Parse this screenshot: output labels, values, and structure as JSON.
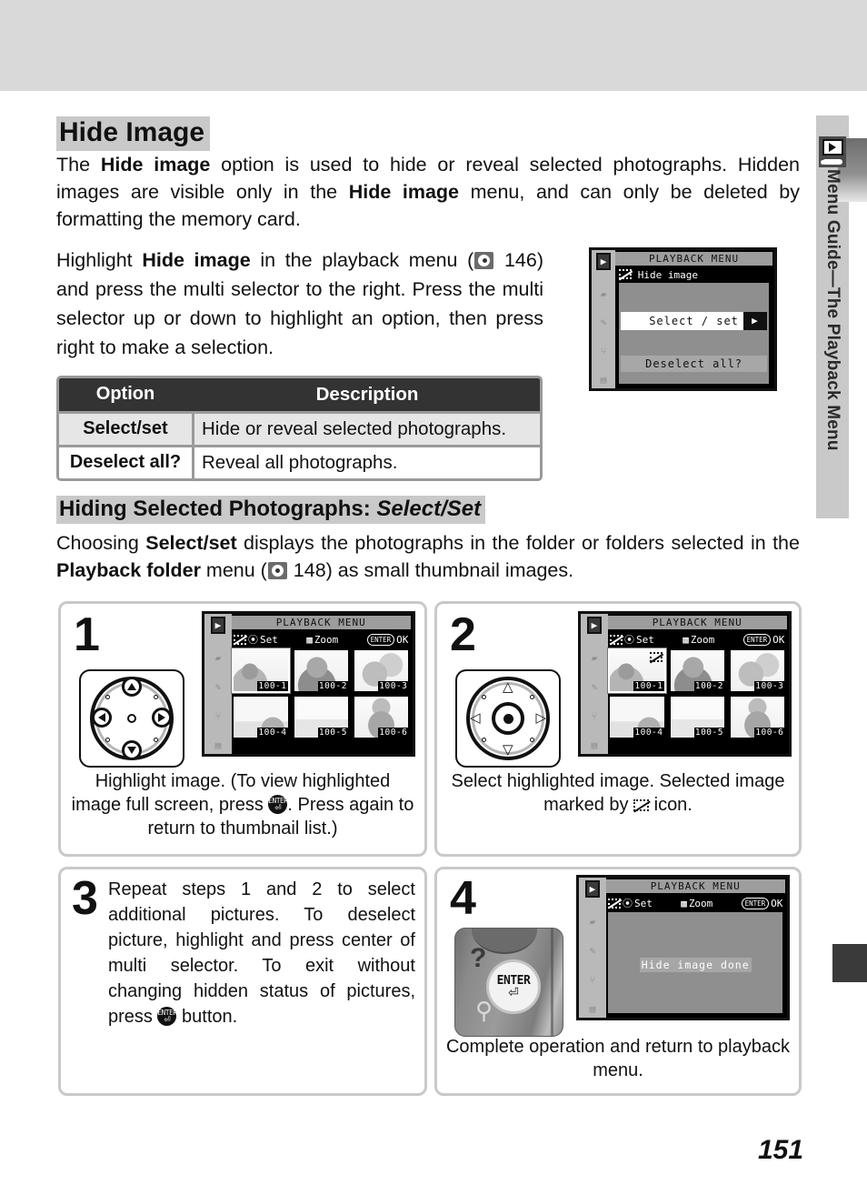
{
  "page": {
    "number": "151",
    "side_tab_label": "Menu Guide—The Playback Menu",
    "side_tab_icon": "playback-monitor-icon"
  },
  "heading": "Hide Image",
  "intro": {
    "part1": "The ",
    "bold1": "Hide image",
    "part2": " option is used to hide or reveal selected photographs.  Hidden images are visible only in the ",
    "bold2": "Hide image",
    "part3": " menu, and can only be deleted by formatting the memory card."
  },
  "instructions": {
    "part1": "Highlight ",
    "bold1": "Hide image",
    "part2": " in the playback menu (",
    "ref_page": " 146) and press the multi selector to the right. Press the multi selector up or down to highlight an option, then press right to make a selection."
  },
  "menu_screen": {
    "title": "PLAYBACK MENU",
    "item": "Hide image",
    "selected_option": "Select / set",
    "selected_arrow": "▶",
    "second_option": "Deselect all?",
    "rail_icons": [
      "playback-icon",
      "shooting-icon",
      "custom-icon",
      "setup-icon",
      "recent-icon"
    ]
  },
  "table": {
    "headers": [
      "Option",
      "Description"
    ],
    "rows": [
      {
        "option": "Select/set",
        "description": "Hide or reveal selected photographs."
      },
      {
        "option": "Deselect all?",
        "description": "Reveal all photographs."
      }
    ]
  },
  "subheading": {
    "normal": "Hiding Selected Photographs: ",
    "italic": "Select/Set"
  },
  "subparagraph": {
    "part1": "Choosing ",
    "bold1": "Select/set",
    "part2": " displays the photographs in the folder or folders selected in the ",
    "bold2": "Playback folder",
    "part3": " menu (",
    "ref_page": " 148) as small thumbnail images."
  },
  "steps": [
    {
      "number": "1",
      "lcd": {
        "title": "PLAYBACK MENU",
        "hints": [
          "Set",
          "Zoom",
          "OK"
        ],
        "hint_keys": [
          "hide-image-icon",
          "center-button-icon",
          "zoom-icon",
          "ENTER"
        ],
        "thumbnails": [
          "100-1",
          "100-2",
          "100-3",
          "100-4",
          "100-5",
          "100-6"
        ],
        "highlighted": "100-1",
        "marked": []
      },
      "control": "multi-selector-directions",
      "caption_1": "Highlight image.  (To view highlighted image full screen, press ",
      "caption_2": ".  Press again to return to thumbnail list.)"
    },
    {
      "number": "2",
      "lcd": {
        "title": "PLAYBACK MENU",
        "hints": [
          "Set",
          "Zoom",
          "OK"
        ],
        "thumbnails": [
          "100-1",
          "100-2",
          "100-3",
          "100-4",
          "100-5",
          "100-6"
        ],
        "highlighted": "100-1",
        "marked": [
          "100-1"
        ]
      },
      "control": "multi-selector-center",
      "caption_1": "Select highlighted image.  Selected image marked by ",
      "caption_2": " icon."
    },
    {
      "number": "3",
      "caption_1": "Repeat steps 1 and 2 to select additional pictures.  To deselect picture, highlight and press center of multi selector.  To exit without changing hidden status of pictures, press ",
      "caption_2": " button."
    },
    {
      "number": "4",
      "lcd": {
        "title": "PLAYBACK MENU",
        "hints": [
          "Set",
          "Zoom",
          "OK"
        ],
        "message": "Hide image done"
      },
      "control": "enter-button-photo",
      "control_labels": {
        "question": "?",
        "magnifier": "magnifier-icon",
        "button": "ENTER"
      },
      "caption_1": "Complete operation and return to playback menu.",
      "caption_2": ""
    }
  ],
  "colors": {
    "band": "#d9d9d9",
    "highlight": "#c9c9c9",
    "table_header": "#333333",
    "lcd_panel": "#8f8f8f"
  }
}
